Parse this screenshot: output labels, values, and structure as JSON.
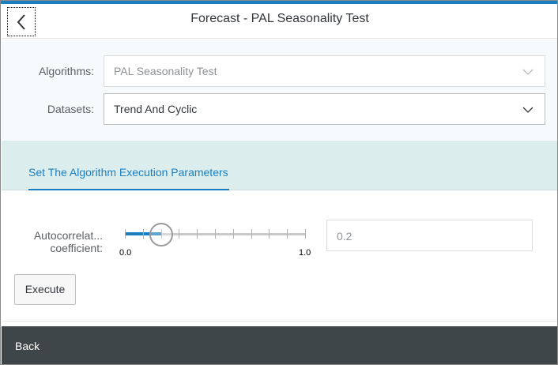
{
  "header": {
    "title": "Forecast - PAL Seasonality Test",
    "back_icon": "chevron-left-icon"
  },
  "form": {
    "algorithms": {
      "label": "Algorithms:",
      "value": "PAL Seasonality Test",
      "disabled": true
    },
    "datasets": {
      "label": "Datasets:",
      "value": "Trend And Cyclic"
    }
  },
  "tabs": [
    {
      "label": "Set The Algorithm Execution Parameters",
      "selected": true
    }
  ],
  "parameter": {
    "label_line1": "Autocorrelat...",
    "label_line2": "coefficient:",
    "slider_min": "0.0",
    "slider_max": "1.0",
    "slider_value": 0.2,
    "tick_count": 10,
    "input_value": "0.2"
  },
  "actions": {
    "execute_label": "Execute"
  },
  "footer": {
    "back_label": "Back"
  },
  "colors": {
    "accent": "#1a7fc0",
    "tab_bar": "#dcedee",
    "footer": "#3f4649"
  }
}
